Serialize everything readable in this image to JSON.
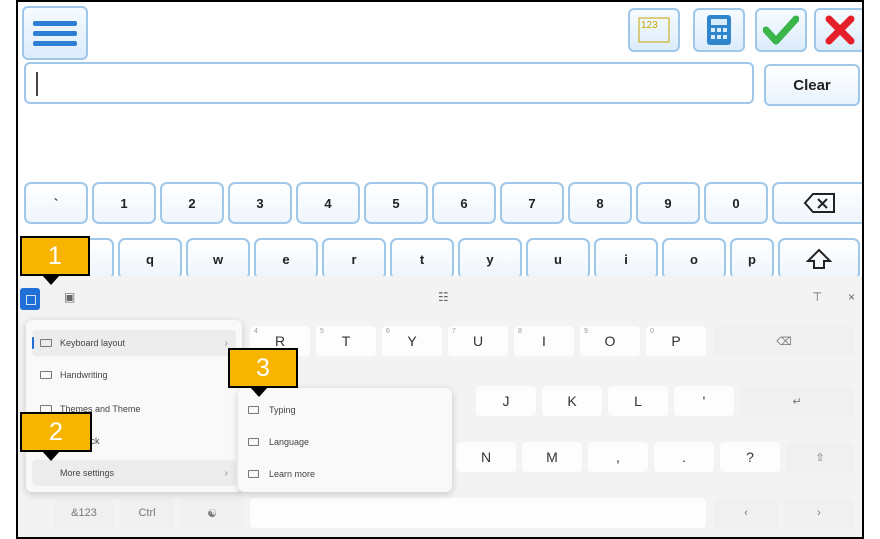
{
  "toolbar": {
    "menu_icon": "hamburger-menu-icon",
    "numbers_icon": "number-pad-icon",
    "numbers_glyph": "123",
    "calculator_icon": "calculator-icon",
    "accept_icon": "green-check-icon",
    "close_icon": "red-x-icon",
    "accent_green": "#39b54a",
    "accent_red": "#e5202a"
  },
  "input": {
    "value": "",
    "placeholder": ""
  },
  "clear_label": "Clear",
  "keys_row1": [
    "`",
    "1",
    "2",
    "3",
    "4",
    "5",
    "6",
    "7",
    "8",
    "9",
    "0"
  ],
  "backspace_icon": "backspace-icon",
  "keys_row2": [
    "q",
    "w",
    "e",
    "r",
    "t",
    "y",
    "u",
    "i",
    "o",
    "p"
  ],
  "shift_icon": "shift-up-icon",
  "touch": {
    "row1": [
      {
        "label": "R",
        "sup": "4"
      },
      {
        "label": "T",
        "sup": "5"
      },
      {
        "label": "Y",
        "sup": "6"
      },
      {
        "label": "U",
        "sup": "7"
      },
      {
        "label": "I",
        "sup": "8"
      },
      {
        "label": "O",
        "sup": "9"
      },
      {
        "label": "P",
        "sup": "0"
      }
    ],
    "row2": [
      "J",
      "K",
      "L",
      "'"
    ],
    "row3": [
      "N",
      "M",
      ",",
      ".",
      "?"
    ],
    "bottom": [
      "&123",
      "Ctrl"
    ],
    "menu": [
      "Keyboard layout",
      "Handwriting",
      "Themes and Theme",
      "Feedback",
      "More settings"
    ],
    "submenu": [
      "Typing",
      "Language",
      "Learn more"
    ]
  },
  "badges": [
    "1",
    "2",
    "3"
  ]
}
